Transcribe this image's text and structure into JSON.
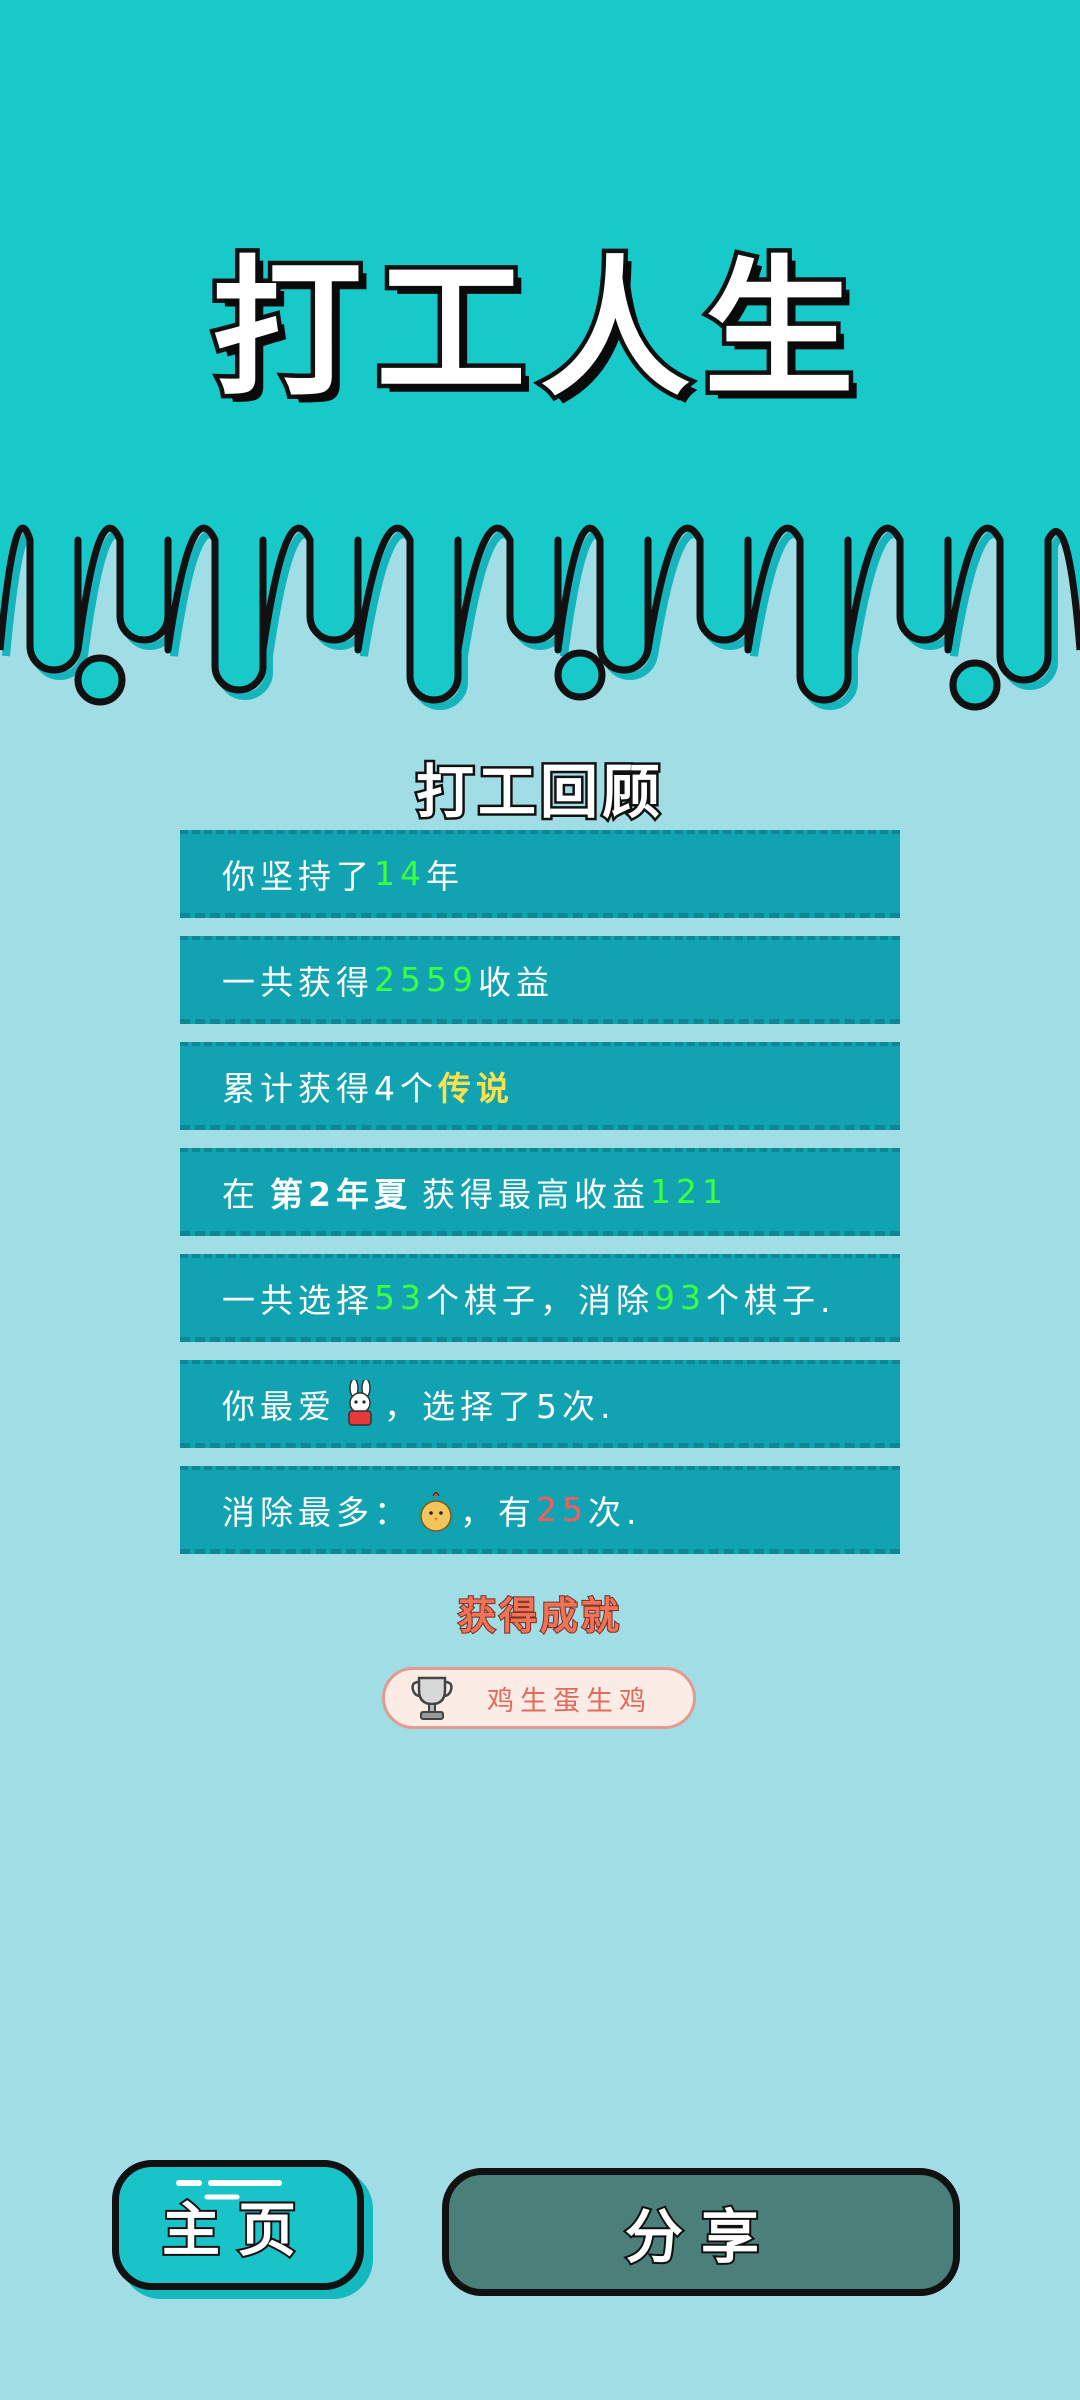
{
  "colors": {
    "header_bg": "#17c9c9",
    "page_bg": "#a0dde4",
    "row_bg": "#12a3b3",
    "highlight_green": "#3dff3d",
    "highlight_yellow": "#ffe14a",
    "highlight_red": "#ff5a5a",
    "home_button": "#19c4c9",
    "share_button": "#4a7f7a"
  },
  "title": "打工人生",
  "review": {
    "title": "打工回顾",
    "rows": [
      {
        "pre": "你坚持了",
        "v": "14",
        "post": "年"
      },
      {
        "pre": "一共获得",
        "v": "2559",
        "post": "收益"
      },
      {
        "pre": "累计获得4个",
        "v": "传说",
        "post": ""
      },
      {
        "pre": "在",
        "b": "第2年夏",
        "mid": "获得最高收益",
        "v": "121"
      },
      {
        "pre": "一共选择",
        "v1": "53",
        "mid": "个棋子，消除",
        "v2": "93",
        "post": "个棋子."
      },
      {
        "pre": "你最爱",
        "post": "，选择了5次.",
        "icon": "rabbit-sprite-icon"
      },
      {
        "pre": "消除最多：",
        "mid": "，有",
        "v": "25",
        "post": "次.",
        "icon": "chick-sprite-icon"
      }
    ]
  },
  "achievement": {
    "title": "获得成就",
    "name": "鸡生蛋生鸡",
    "icon": "trophy-icon"
  },
  "buttons": {
    "home": "主页",
    "share": "分享"
  }
}
